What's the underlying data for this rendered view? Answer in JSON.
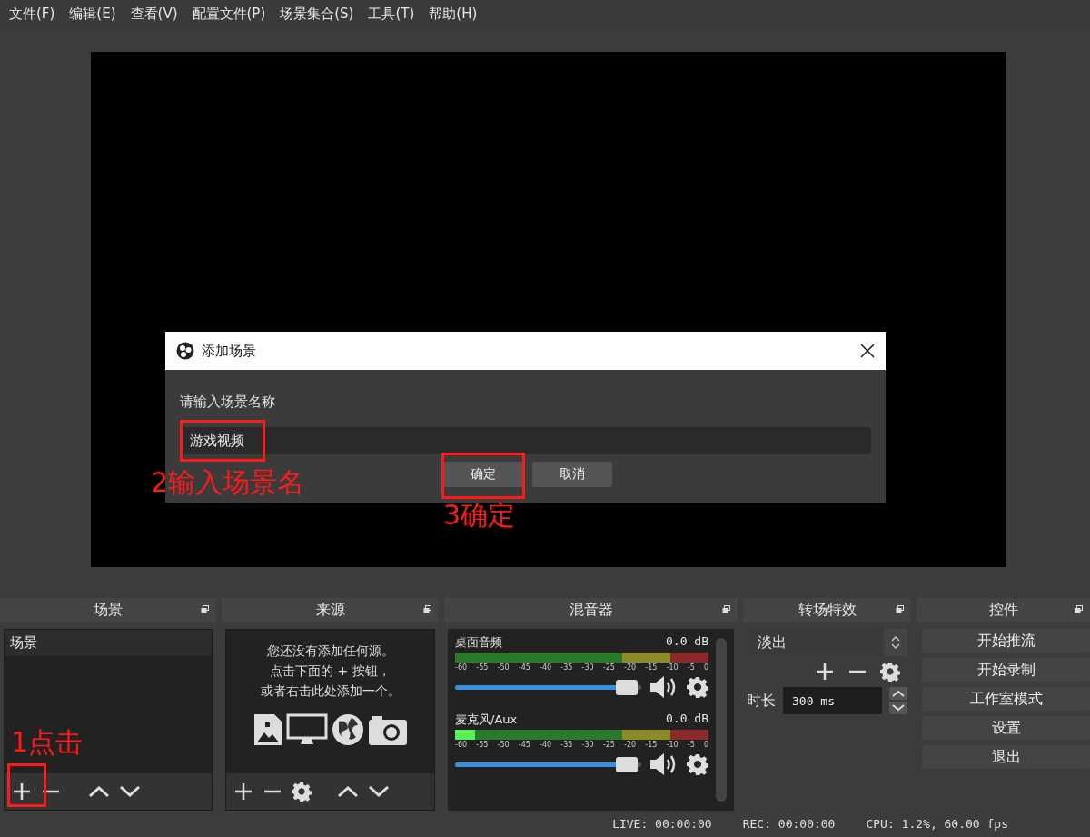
{
  "menu": [
    "文件(F)",
    "编辑(E)",
    "查看(V)",
    "配置文件(P)",
    "场景集合(S)",
    "工具(T)",
    "帮助(H)"
  ],
  "dialog": {
    "title": "添加场景",
    "prompt": "请输入场景名称",
    "value": "游戏视频",
    "buttons": [
      "确定",
      "取消"
    ]
  },
  "scenes": {
    "title": "场景",
    "items": [
      "场景"
    ]
  },
  "sources": {
    "title": "来源",
    "empty_hint": [
      "您还没有添加任何源。",
      "点击下面的 + 按钮，",
      "或者右击此处添加一个。"
    ]
  },
  "mixer": {
    "title": "混音器",
    "channels": [
      {
        "name": "桌面音频",
        "reading": "0.0 dB",
        "meter": {
          "level": 0
        },
        "ticks": [
          "-60",
          "-55",
          "-50",
          "-45",
          "-40",
          "-35",
          "-30",
          "-25",
          "-20",
          "-15",
          "-10",
          "-5",
          "0"
        ],
        "volume": {
          "level": 0.92
        }
      },
      {
        "name": "麦克风/Aux",
        "reading": "0.0 dB",
        "meter": {
          "level": 0.08
        },
        "ticks": [
          "-60",
          "-55",
          "-50",
          "-45",
          "-40",
          "-35",
          "-30",
          "-25",
          "-20",
          "-15",
          "-10",
          "-5",
          "0"
        ],
        "volume": {
          "level": 0.92
        }
      }
    ]
  },
  "transitions": {
    "title": "转场特效",
    "effect": "淡出",
    "duration_label": "时长",
    "duration": "300 ms"
  },
  "controls": {
    "title": "控件",
    "buttons": [
      "开始推流",
      "开始录制",
      "工作室模式",
      "设置",
      "退出"
    ]
  },
  "status_bar": {
    "live": "LIVE: 00:00:00",
    "rec": "REC: 00:00:00",
    "cpu": "CPU: 1.2%, 60.00 fps"
  },
  "annotations": [
    {
      "kind": "label",
      "text": "1点击"
    },
    {
      "kind": "box"
    },
    {
      "kind": "label",
      "text": "2输入场景名"
    },
    {
      "kind": "box"
    },
    {
      "kind": "label",
      "text": "3确定"
    },
    {
      "kind": "box"
    }
  ]
}
